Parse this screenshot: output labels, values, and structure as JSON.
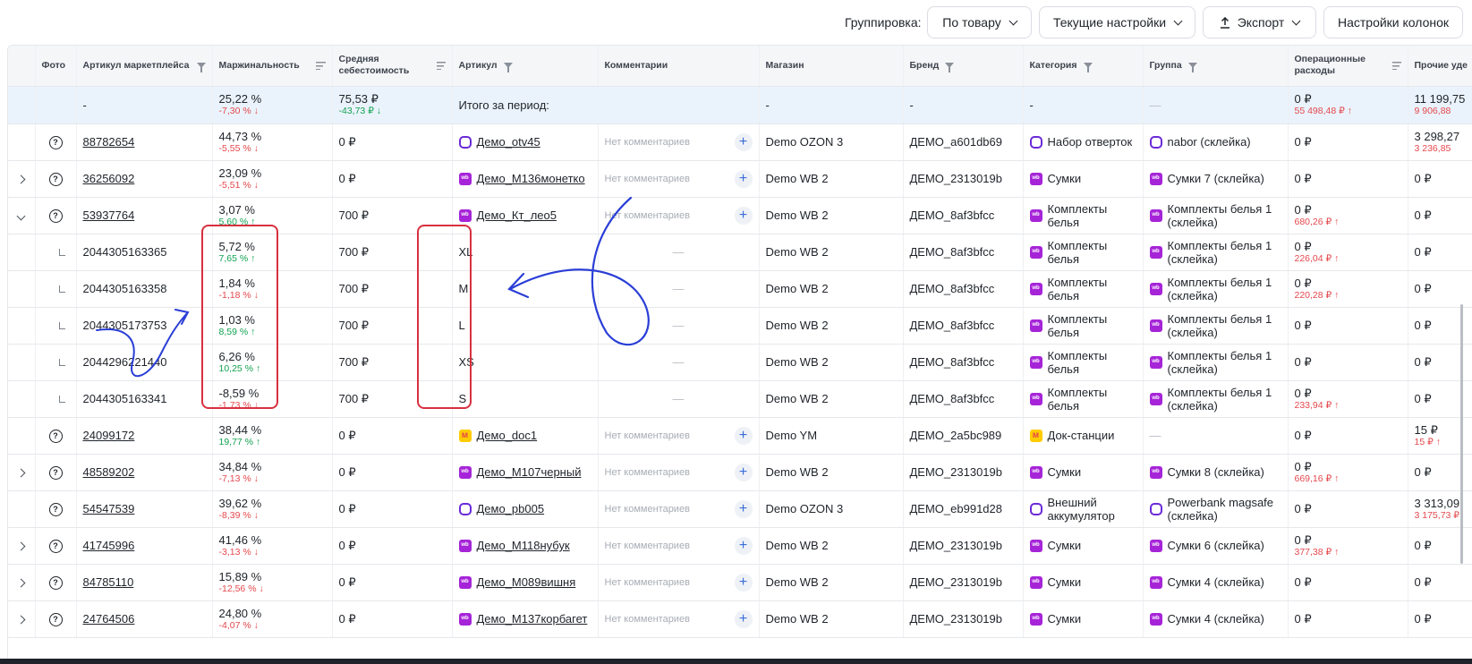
{
  "toolbar": {
    "group_label": "Группировка:",
    "group_value": "По товару",
    "settings": "Текущие настройки",
    "export": "Экспорт",
    "columns": "Настройки колонок",
    "export_icon": "upload-icon"
  },
  "columns": {
    "photo": "Фото",
    "sku_mp": "Артикул маркетплейса",
    "margin": "Маржинальность",
    "avg_cost": "Средняя себестоимость",
    "sku": "Артикул",
    "comments": "Комментарии",
    "shop": "Магазин",
    "brand": "Бренд",
    "category": "Категория",
    "group": "Группа",
    "op_costs": "Операционные расходы",
    "other": "Прочие уде"
  },
  "total": {
    "sku_mp": "-",
    "margin": "25,22 %",
    "margin_delta": "-7,30 %",
    "cost": "75,53 ₽",
    "cost_delta": "-43,73 ₽",
    "label": "Итого за период:",
    "shop": "-",
    "brand": "-",
    "category": "-",
    "group": "—",
    "op": "0 ₽",
    "op_delta": "55 498,48 ₽",
    "other": "11 199,75",
    "other_delta": "9 906,88"
  },
  "rows": [
    {
      "expand": "",
      "sub": false,
      "sku_mp": "88782654",
      "margin": "44,73 %",
      "mdelta": "-5,55 %",
      "mdir": "down",
      "cost": "0 ₽",
      "mp": "ozon",
      "sku": "Демо_otv45",
      "comment": "Нет комментариев",
      "shop": "Demo OZON 3",
      "brand": "ДЕМО_a601db69",
      "category": "Набор отверток",
      "gmp": "ozon",
      "group": "nabor (склейка)",
      "op": "0 ₽",
      "opdelta": "",
      "other": "3 298,27",
      "otherdelta": "3 236,85"
    },
    {
      "expand": "closed",
      "sub": false,
      "sku_mp": "36256092",
      "margin": "23,09 %",
      "mdelta": "-5,51 %",
      "mdir": "down",
      "cost": "0 ₽",
      "mp": "wb",
      "sku": "Демо_М136монетко",
      "comment": "Нет комментариев",
      "shop": "Demo WB 2",
      "brand": "ДЕМО_2313019b",
      "category": "Сумки",
      "gmp": "wb",
      "group": "Сумки 7 (склейка)",
      "op": "0 ₽",
      "opdelta": "",
      "other": "0 ₽",
      "otherdelta": ""
    },
    {
      "expand": "open",
      "sub": false,
      "sku_mp": "53937764",
      "margin": "3,07 %",
      "mdelta": "5,60 %",
      "mdir": "up",
      "cost": "700 ₽",
      "mp": "wb",
      "sku": "Демо_Кт_лео5",
      "comment": "Нет комментариев",
      "shop": "Demo WB 2",
      "brand": "ДЕМО_8af3bfcc",
      "category": "Комплекты белья",
      "gmp": "wb",
      "group": "Комплекты белья 1 (склейка)",
      "op": "0 ₽",
      "opdelta": "680,26 ₽",
      "other": "0 ₽",
      "otherdelta": ""
    },
    {
      "expand": "",
      "sub": true,
      "sku_mp": "2044305163365",
      "margin": "5,72 %",
      "mdelta": "7,65 %",
      "mdir": "up",
      "cost": "700 ₽",
      "mp": "",
      "sku": "XL",
      "comment": "—",
      "shop": "Demo WB 2",
      "brand": "ДЕМО_8af3bfcc",
      "category": "Комплекты белья",
      "gmp": "wb",
      "group": "Комплекты белья 1 (склейка)",
      "op": "0 ₽",
      "opdelta": "226,04 ₽",
      "other": "0 ₽",
      "otherdelta": ""
    },
    {
      "expand": "",
      "sub": true,
      "sku_mp": "2044305163358",
      "margin": "1,84 %",
      "mdelta": "-1,18 %",
      "mdir": "down",
      "cost": "700 ₽",
      "mp": "",
      "sku": "M",
      "comment": "—",
      "shop": "Demo WB 2",
      "brand": "ДЕМО_8af3bfcc",
      "category": "Комплекты белья",
      "gmp": "wb",
      "group": "Комплекты белья 1 (склейка)",
      "op": "0 ₽",
      "opdelta": "220,28 ₽",
      "other": "0 ₽",
      "otherdelta": ""
    },
    {
      "expand": "",
      "sub": true,
      "sku_mp": "2044305173753",
      "margin": "1,03 %",
      "mdelta": "8,59 %",
      "mdir": "up",
      "cost": "700 ₽",
      "mp": "",
      "sku": "L",
      "comment": "—",
      "shop": "Demo WB 2",
      "brand": "ДЕМО_8af3bfcc",
      "category": "Комплекты белья",
      "gmp": "wb",
      "group": "Комплекты белья 1 (склейка)",
      "op": "0 ₽",
      "opdelta": "",
      "other": "0 ₽",
      "otherdelta": ""
    },
    {
      "expand": "",
      "sub": true,
      "sku_mp": "2044296221440",
      "margin": "6,26 %",
      "mdelta": "10,25 %",
      "mdir": "up",
      "cost": "700 ₽",
      "mp": "",
      "sku": "XS",
      "comment": "—",
      "shop": "Demo WB 2",
      "brand": "ДЕМО_8af3bfcc",
      "category": "Комплекты белья",
      "gmp": "wb",
      "group": "Комплекты белья 1 (склейка)",
      "op": "0 ₽",
      "opdelta": "",
      "other": "0 ₽",
      "otherdelta": ""
    },
    {
      "expand": "",
      "sub": true,
      "sku_mp": "2044305163341",
      "margin": "-8,59 %",
      "mdelta": "-1,73 %",
      "mdir": "down",
      "cost": "700 ₽",
      "mp": "",
      "sku": "S",
      "comment": "—",
      "shop": "Demo WB 2",
      "brand": "ДЕМО_8af3bfcc",
      "category": "Комплекты белья",
      "gmp": "wb",
      "group": "Комплекты белья 1 (склейка)",
      "op": "0 ₽",
      "opdelta": "233,94 ₽",
      "other": "0 ₽",
      "otherdelta": ""
    },
    {
      "expand": "",
      "sub": false,
      "sku_mp": "24099172",
      "margin": "38,44 %",
      "mdelta": "19,77 %",
      "mdir": "up",
      "cost": "0 ₽",
      "mp": "ym",
      "sku": "Демо_doc1",
      "comment": "Нет комментариев",
      "shop": "Demo YM",
      "brand": "ДЕМО_2a5bc989",
      "category": "Док-станции",
      "gmp": "ym",
      "group": "—",
      "op": "0 ₽",
      "opdelta": "",
      "other": "15 ₽",
      "otherdelta": "15 ₽"
    },
    {
      "expand": "closed",
      "sub": false,
      "sku_mp": "48589202",
      "margin": "34,84 %",
      "mdelta": "-7,13 %",
      "mdir": "down",
      "cost": "0 ₽",
      "mp": "wb",
      "sku": "Демо_М107черный",
      "comment": "Нет комментариев",
      "shop": "Demo WB 2",
      "brand": "ДЕМО_2313019b",
      "category": "Сумки",
      "gmp": "wb",
      "group": "Сумки 8 (склейка)",
      "op": "0 ₽",
      "opdelta": "669,16 ₽",
      "other": "0 ₽",
      "otherdelta": ""
    },
    {
      "expand": "",
      "sub": false,
      "sku_mp": "54547539",
      "margin": "39,62 %",
      "mdelta": "-8,39 %",
      "mdir": "down",
      "cost": "0 ₽",
      "mp": "ozon",
      "sku": "Демо_pb005",
      "comment": "Нет комментариев",
      "shop": "Demo OZON 3",
      "brand": "ДЕМО_eb991d28",
      "category": "Внешний аккумулятор",
      "gmp": "ozon",
      "group": "Powerbank magsafe (склейка)",
      "op": "0 ₽",
      "opdelta": "",
      "other": "3 313,09",
      "otherdelta": "3 175,73 ₽"
    },
    {
      "expand": "closed",
      "sub": false,
      "sku_mp": "41745996",
      "margin": "41,46 %",
      "mdelta": "-3,13 %",
      "mdir": "down",
      "cost": "0 ₽",
      "mp": "wb",
      "sku": "Демо_М118нубук",
      "comment": "Нет комментариев",
      "shop": "Demo WB 2",
      "brand": "ДЕМО_2313019b",
      "category": "Сумки",
      "gmp": "wb",
      "group": "Сумки 6 (склейка)",
      "op": "0 ₽",
      "opdelta": "377,38 ₽",
      "other": "0 ₽",
      "otherdelta": ""
    },
    {
      "expand": "closed",
      "sub": false,
      "sku_mp": "84785110",
      "margin": "15,89 %",
      "mdelta": "-12,56 %",
      "mdir": "down",
      "cost": "0 ₽",
      "mp": "wb",
      "sku": "Демо_М089вишня",
      "comment": "Нет комментариев",
      "shop": "Demo WB 2",
      "brand": "ДЕМО_2313019b",
      "category": "Сумки",
      "gmp": "wb",
      "group": "Сумки 4 (склейка)",
      "op": "0 ₽",
      "opdelta": "",
      "other": "0 ₽",
      "otherdelta": ""
    },
    {
      "expand": "closed",
      "sub": false,
      "sku_mp": "24764506",
      "margin": "24,80 %",
      "mdelta": "-4,07 %",
      "mdir": "down",
      "cost": "0 ₽",
      "mp": "wb",
      "sku": "Демо_М137корбагет",
      "comment": "Нет комментариев",
      "shop": "Demo WB 2",
      "brand": "ДЕМО_2313019b",
      "category": "Сумки",
      "gmp": "wb",
      "group": "Сумки 4 (склейка)",
      "op": "0 ₽",
      "opdelta": "",
      "other": "0 ₽",
      "otherdelta": ""
    }
  ],
  "colors": {
    "negative": "#e5484d",
    "positive": "#12a150",
    "total_bg": "#eaf3fb",
    "annotation_red": "#d8303f",
    "annotation_blue": "#2a3ed6",
    "wb": "#a624d8",
    "ozon": "#6b2ad8",
    "ym": "#ffcc00"
  },
  "icons": {
    "photo": "question-circle-icon",
    "filter": "funnel-icon",
    "sort": "sort-icon",
    "add_comment": "plus-icon",
    "expand": "chevron-right-icon"
  }
}
